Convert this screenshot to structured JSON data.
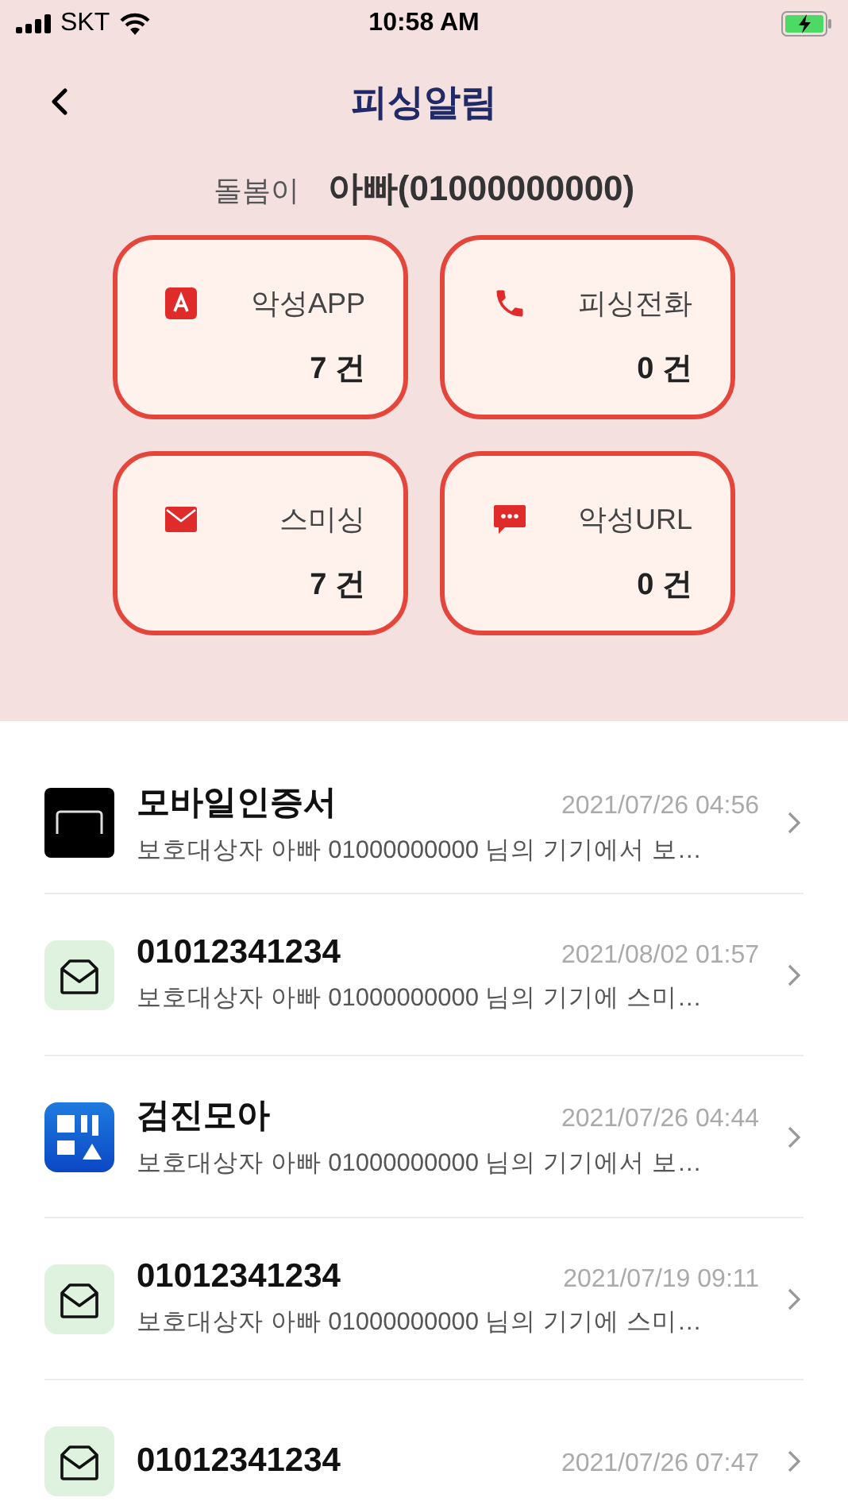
{
  "status_bar": {
    "carrier": "SKT",
    "time": "10:58 AM"
  },
  "header": {
    "title": "피싱알림"
  },
  "guardian": {
    "label": "돌봄이",
    "value": "아빠(01000000000)"
  },
  "cards": [
    {
      "kind": "app",
      "label": "악성APP",
      "count": "7 건"
    },
    {
      "kind": "call",
      "label": "피싱전화",
      "count": "0 건"
    },
    {
      "kind": "sms",
      "label": "스미싱",
      "count": "7 건"
    },
    {
      "kind": "url",
      "label": "악성URL",
      "count": "0 건"
    }
  ],
  "alerts": [
    {
      "kind": "app",
      "title": "모바일인증서",
      "date": "2021/07/26 04:56",
      "preview": "보호대상자 아빠 01000000000 님의 기기에서 보…"
    },
    {
      "kind": "sms",
      "title": "01012341234",
      "date": "2021/08/02 01:57",
      "preview": "보호대상자 아빠 01000000000 님의 기기에 스미…"
    },
    {
      "kind": "logo",
      "title": "검진모아",
      "date": "2021/07/26 04:44",
      "preview": "보호대상자 아빠 01000000000 님의 기기에서 보…"
    },
    {
      "kind": "sms",
      "title": "01012341234",
      "date": "2021/07/19 09:11",
      "preview": "보호대상자 아빠 01000000000 님의 기기에 스미…"
    },
    {
      "kind": "sms",
      "title": "01012341234",
      "date": "2021/07/26 07:47"
    }
  ]
}
